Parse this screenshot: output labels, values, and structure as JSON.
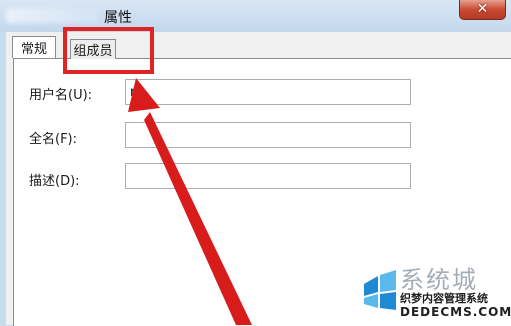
{
  "window": {
    "title_suffix": "属性",
    "close_label": "✕"
  },
  "tabs": [
    {
      "label": "常规",
      "active": true
    },
    {
      "label": "组成员",
      "active": false
    }
  ],
  "form": {
    "username_label": "用户名(U):",
    "username_value": "r",
    "fullname_label": "全名(F):",
    "fullname_value": "",
    "description_label": "描述(D):",
    "description_value": ""
  },
  "annotation": {
    "color": "#e02424",
    "highlights": "tab-members"
  },
  "watermark": {
    "logo_text": "系统城",
    "subtitle": "织梦内容管理系统",
    "url": "DEDECMS.COM",
    "logo_colors": [
      "#1e8ad6",
      "#59b8ec"
    ]
  }
}
